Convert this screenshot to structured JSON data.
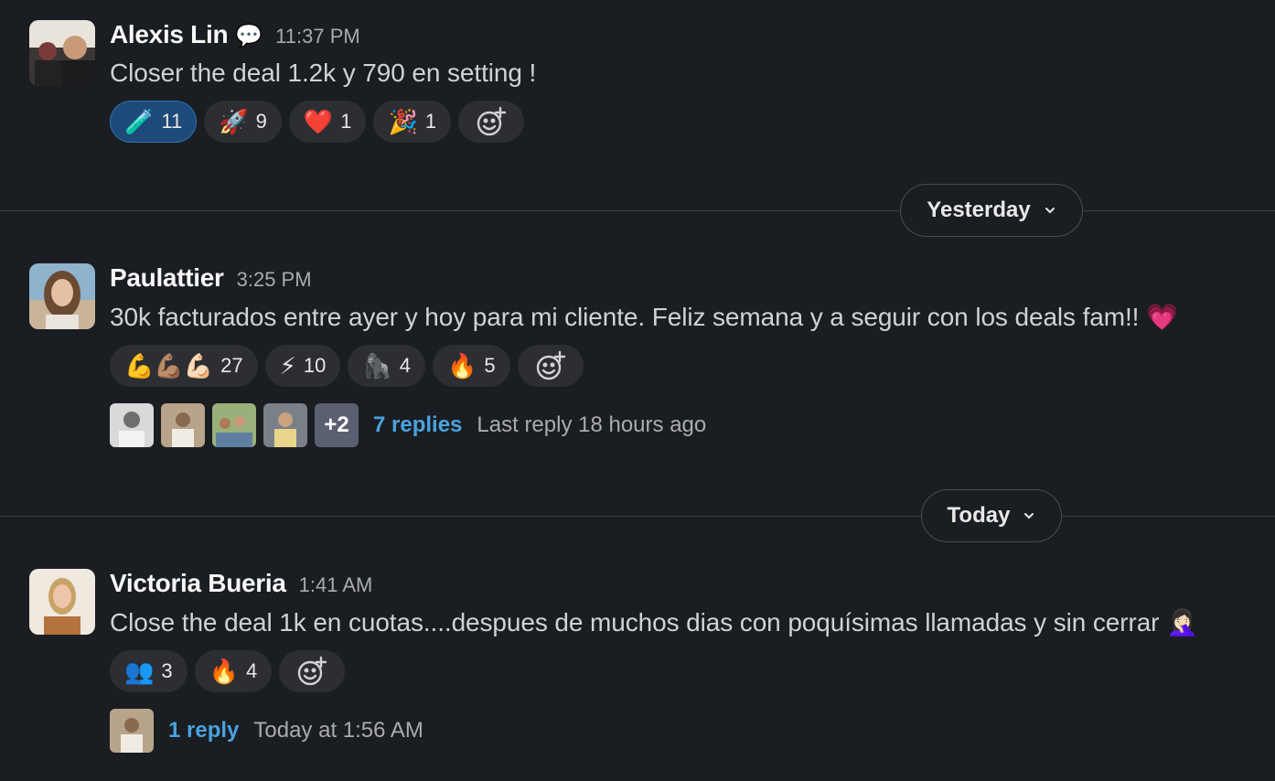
{
  "messages": [
    {
      "name": "Alexis Lin",
      "status_emoji": "💬",
      "time": "11:37 PM",
      "text": "Closer the deal 1.2k y 790 en setting !",
      "reactions": [
        {
          "emoji": "🧪",
          "count": "11",
          "active": true
        },
        {
          "emoji": "🚀",
          "count": "9"
        },
        {
          "emoji": "❤️",
          "count": "1"
        },
        {
          "emoji": "🎉",
          "count": "1"
        }
      ]
    },
    {
      "name": "Paulattier",
      "time": "3:25 PM",
      "text": "30k facturados entre ayer y hoy para mi cliente. Feliz semana y a seguir con los deals fam!! 💗",
      "reactions": [
        {
          "emoji": "💪💪🏽💪🏻",
          "count": "27"
        },
        {
          "emoji": "⚡",
          "count": "10"
        },
        {
          "emoji": "🦍",
          "count": "4"
        },
        {
          "emoji": "🔥",
          "count": "5"
        }
      ],
      "thread": {
        "more": "+2",
        "replies": "7 replies",
        "last": "Last reply 18 hours ago"
      }
    },
    {
      "name": "Victoria Bueria",
      "time": "1:41 AM",
      "text": "Close the deal 1k en cuotas....despues de muchos dias con poquísimas llamadas y sin cerrar 🤦🏻‍♀️",
      "reactions": [
        {
          "emoji": "👥",
          "count": "3"
        },
        {
          "emoji": "🔥",
          "count": "4"
        }
      ],
      "thread": {
        "replies": "1 reply",
        "last": "Today at 1:56 AM"
      }
    }
  ],
  "dividers": {
    "yesterday": "Yesterday",
    "today": "Today"
  },
  "colors": {
    "background": "#1a1d21",
    "link": "#4aa3df",
    "active_reaction": "#1d4a78"
  }
}
